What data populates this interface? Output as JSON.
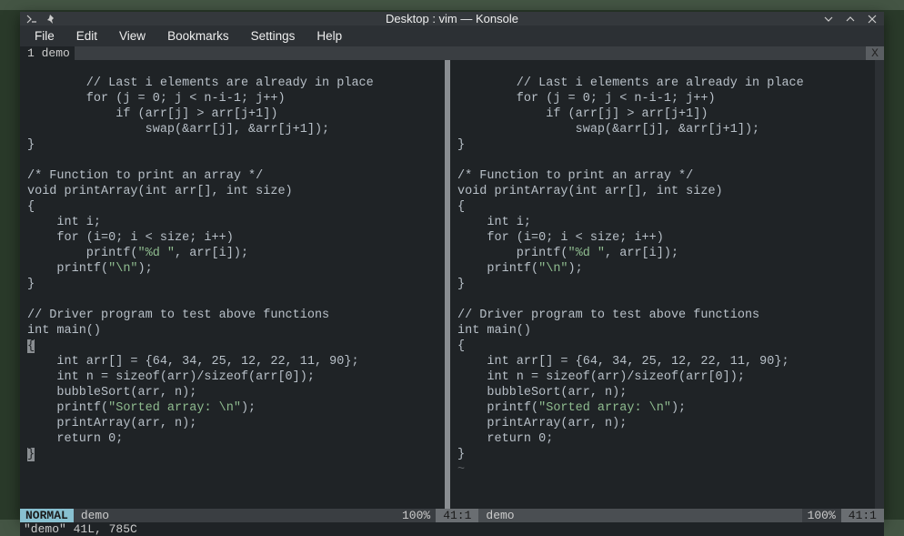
{
  "titlebar": {
    "title": "Desktop : vim — Konsole"
  },
  "menubar": [
    "File",
    "Edit",
    "View",
    "Bookmarks",
    "Settings",
    "Help"
  ],
  "tab": {
    "num": "1",
    "name": "demo",
    "close": "X"
  },
  "code": {
    "l1": "        // Last i elements are already in place",
    "l2": "        for (j = 0; j < n-i-1; j++)",
    "l3": "            if (arr[j] > arr[j+1])",
    "l4": "                swap(&arr[j], &arr[j+1]);",
    "l5": "}",
    "l6": "",
    "l7": "/* Function to print an array */",
    "l8": "void printArray(int arr[], int size)",
    "l9": "{",
    "l10": "    int i;",
    "l11": "    for (i=0; i < size; i++)",
    "l12a": "        printf(",
    "l12b": "\"%d \"",
    "l12c": ", arr[i]);",
    "l13a": "    printf(",
    "l13b": "\"\\n\"",
    "l13c": ");",
    "l14": "}",
    "l15": "",
    "l16": "// Driver program to test above functions",
    "l17": "int main()",
    "l18a": "{",
    "l18b": "{",
    "l19": "    int arr[] = {64, 34, 25, 12, 22, 11, 90};",
    "l20": "    int n = sizeof(arr)/sizeof(arr[0]);",
    "l21": "    bubbleSort(arr, n);",
    "l22a": "    printf(",
    "l22b": "\"Sorted array: \\n\"",
    "l22c": ");",
    "l23": "    printArray(arr, n);",
    "l24": "    return 0;",
    "l25a": "}",
    "l25b": "}",
    "tilde": "~"
  },
  "status": {
    "left": {
      "mode": "NORMAL",
      "file": "demo",
      "pct": "100%",
      "pos": "41:1"
    },
    "right": {
      "file": "demo",
      "pct": "100%",
      "pos": "41:1"
    }
  },
  "cmdline": "\"demo\" 41L, 785C"
}
